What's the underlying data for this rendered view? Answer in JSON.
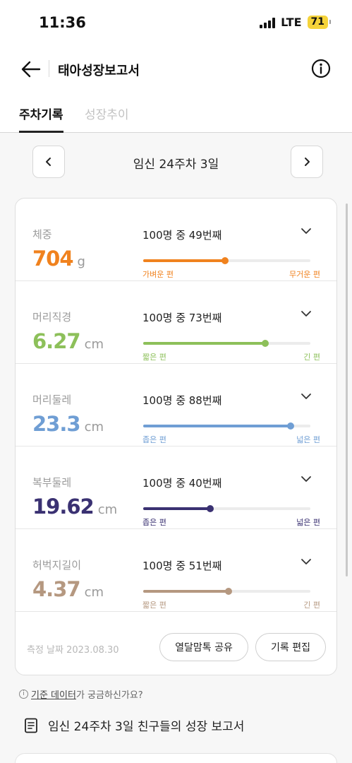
{
  "status_bar": {
    "time": "11:36",
    "network": "LTE",
    "battery": "71"
  },
  "header": {
    "title": "태아성장보고서"
  },
  "tabs": [
    {
      "label": "주차기록"
    },
    {
      "label": "성장추이"
    }
  ],
  "week": {
    "label": "임신 24주차 3일"
  },
  "metrics": [
    {
      "name": "체중",
      "value": "704",
      "unit": "g",
      "rank": "100명 중 49번째",
      "percentile": 0.49,
      "color": "#f0821e",
      "label_left": "가벼운 편",
      "label_right": "무거운 편"
    },
    {
      "name": "머리직경",
      "value": "6.27",
      "unit": "cm",
      "rank": "100명 중 73번째",
      "percentile": 0.73,
      "color": "#8dc05a",
      "label_left": "짧은 편",
      "label_right": "긴 편"
    },
    {
      "name": "머리둘레",
      "value": "23.3",
      "unit": "cm",
      "rank": "100명 중 88번째",
      "percentile": 0.88,
      "color": "#6f9ed4",
      "label_left": "좁은 편",
      "label_right": "넓은 편"
    },
    {
      "name": "복부둘레",
      "value": "19.62",
      "unit": "cm",
      "rank": "100명 중 40번째",
      "percentile": 0.4,
      "color": "#3a3172",
      "label_left": "좁은 편",
      "label_right": "넓은 편"
    },
    {
      "name": "허벅지길이",
      "value": "4.37",
      "unit": "cm",
      "rank": "100명 중 51번째",
      "percentile": 0.51,
      "color": "#b59880",
      "label_left": "짧은 편",
      "label_right": "긴 편"
    }
  ],
  "footer": {
    "measure_date": "측정 날짜 2023.08.30",
    "share_label": "열달맘톡 공유",
    "edit_label": "기록 편집"
  },
  "help": {
    "link_text": "기준 데이터",
    "suffix": "가 궁금하신가요?",
    "icon": "info-icon"
  },
  "friends": {
    "title": "임신 24주차 3일 친구들의 성장 보고서",
    "icon": "document-icon"
  }
}
